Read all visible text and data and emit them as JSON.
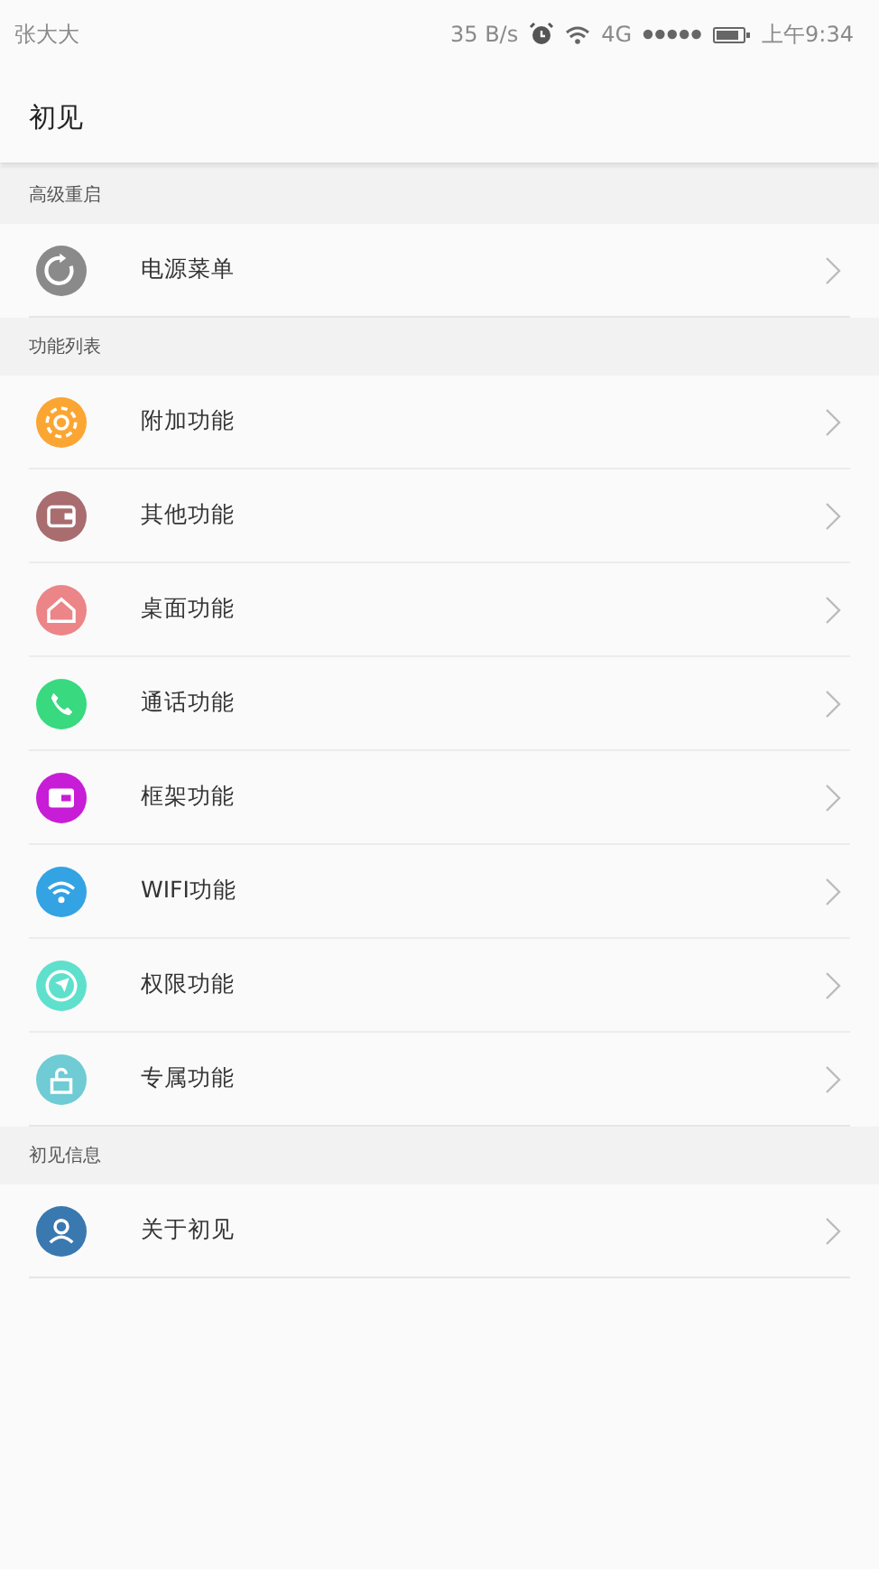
{
  "status_bar": {
    "carrier": "张大大",
    "speed": "35 B/s",
    "network": "4G",
    "time": "上午9:34"
  },
  "app_bar": {
    "title": "初见"
  },
  "sections": [
    {
      "title": "高级重启",
      "items": [
        {
          "label": "电源菜单",
          "color": "#8a8a8a"
        }
      ]
    },
    {
      "title": "功能列表",
      "items": [
        {
          "label": "附加功能",
          "color": "#fba633"
        },
        {
          "label": "其他功能",
          "color": "#a96d6f"
        },
        {
          "label": "桌面功能",
          "color": "#ec8587"
        },
        {
          "label": "通话功能",
          "color": "#38d97f"
        },
        {
          "label": "框架功能",
          "color": "#c71dd6"
        },
        {
          "label": "WIFI功能",
          "color": "#33a3e4"
        },
        {
          "label": "权限功能",
          "color": "#5fe0cd"
        },
        {
          "label": "专属功能",
          "color": "#6fcbd4"
        }
      ]
    },
    {
      "title": "初见信息",
      "items": [
        {
          "label": "关于初见",
          "color": "#3a78b0"
        }
      ]
    }
  ]
}
